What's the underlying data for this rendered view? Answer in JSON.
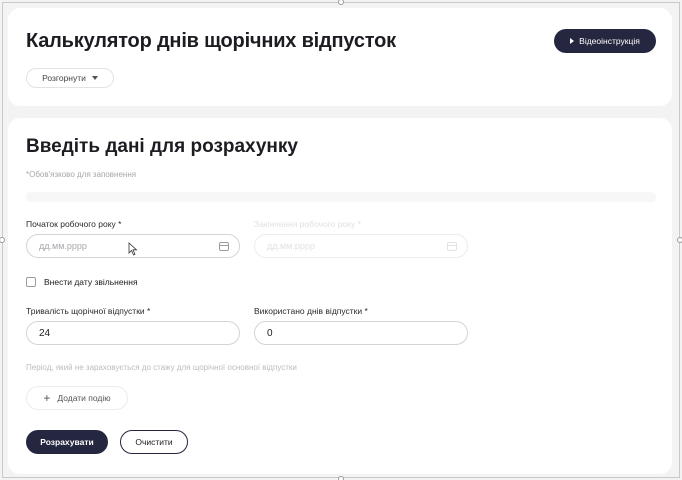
{
  "header": {
    "title": "Калькулятор днів щорічних відпусток",
    "video_button": "Відеоінструкція",
    "expand_button": "Розгорнути"
  },
  "form": {
    "title": "Введіть дані для розрахунку",
    "required_note": "*Обов'язково для заповнення",
    "work_year_start": {
      "label": "Початок робочого року *",
      "placeholder": "дд.мм.рррр"
    },
    "work_year_end": {
      "label": "Закінчення робочого року *",
      "placeholder": "дд.мм.рррр"
    },
    "dismissal_checkbox": {
      "label": "Внести дату звільнення",
      "checked": false
    },
    "annual_leave_duration": {
      "label": "Тривалість щорічної відпустки *",
      "value": "24"
    },
    "used_days": {
      "label": "Використано днів відпустки *",
      "value": "0"
    },
    "period_note": "Період, який не зараховується до стажу для щорічної основної відпустки",
    "add_event_button": "Додати подію",
    "calculate_button": "Розрахувати",
    "clear_button": "Очистити"
  },
  "colors": {
    "primary": "#25263f",
    "background": "#f3f3f4",
    "card": "#ffffff"
  },
  "icons": [
    "play-icon",
    "caret-down-icon",
    "calendar-icon",
    "plus-icon",
    "cursor-icon"
  ]
}
